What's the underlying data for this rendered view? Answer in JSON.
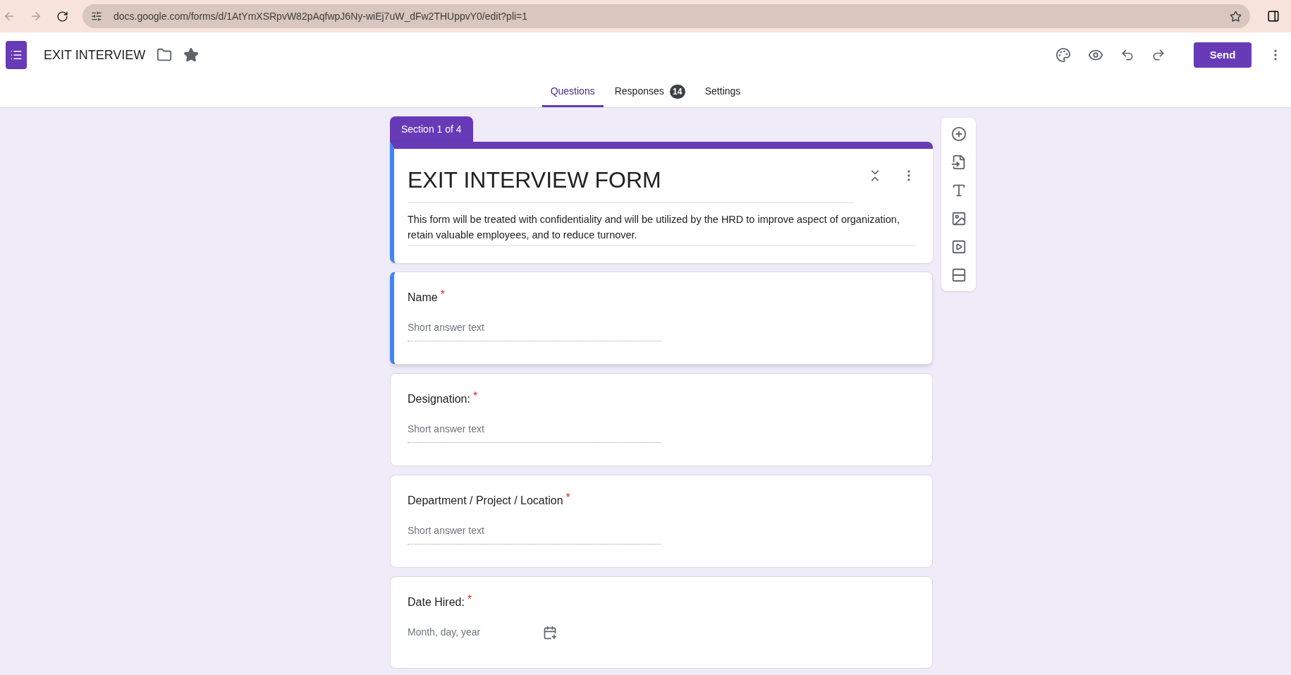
{
  "browser": {
    "url": "docs.google.com/forms/d/1AtYmXSRpvW82pAqfwpJ6Ny-wiEj7uW_dFw2THUppvY0/edit?pli=1"
  },
  "app_bar": {
    "title": "EXIT INTERVIEW",
    "send_label": "Send"
  },
  "tabs": [
    {
      "label": "Questions",
      "selected": true
    },
    {
      "label": "Responses",
      "selected": false,
      "badge": "14"
    },
    {
      "label": "Settings",
      "selected": false
    }
  ],
  "section_label": "Section 1 of 4",
  "form_header": {
    "title": "EXIT INTERVIEW FORM",
    "description": "This form will be treated with confidentiality and will be utilized by the HRD to improve aspect of organization, retain valuable employees, and to reduce turnover.",
    "selected": true
  },
  "questions": [
    {
      "kind": "text",
      "label": "Name",
      "required_mark": "*",
      "placeholder": "Short answer text",
      "selected": true
    },
    {
      "kind": "text",
      "label": "Designation:",
      "required_mark": "*",
      "placeholder": "Short answer text",
      "selected": false
    },
    {
      "kind": "text",
      "label": "Department / Project / Location",
      "required_mark": "*",
      "placeholder": "Short answer text",
      "selected": false
    },
    {
      "kind": "date",
      "label": "Date Hired:",
      "required_mark": "*",
      "placeholder": "Month, day, year",
      "selected": false
    }
  ]
}
